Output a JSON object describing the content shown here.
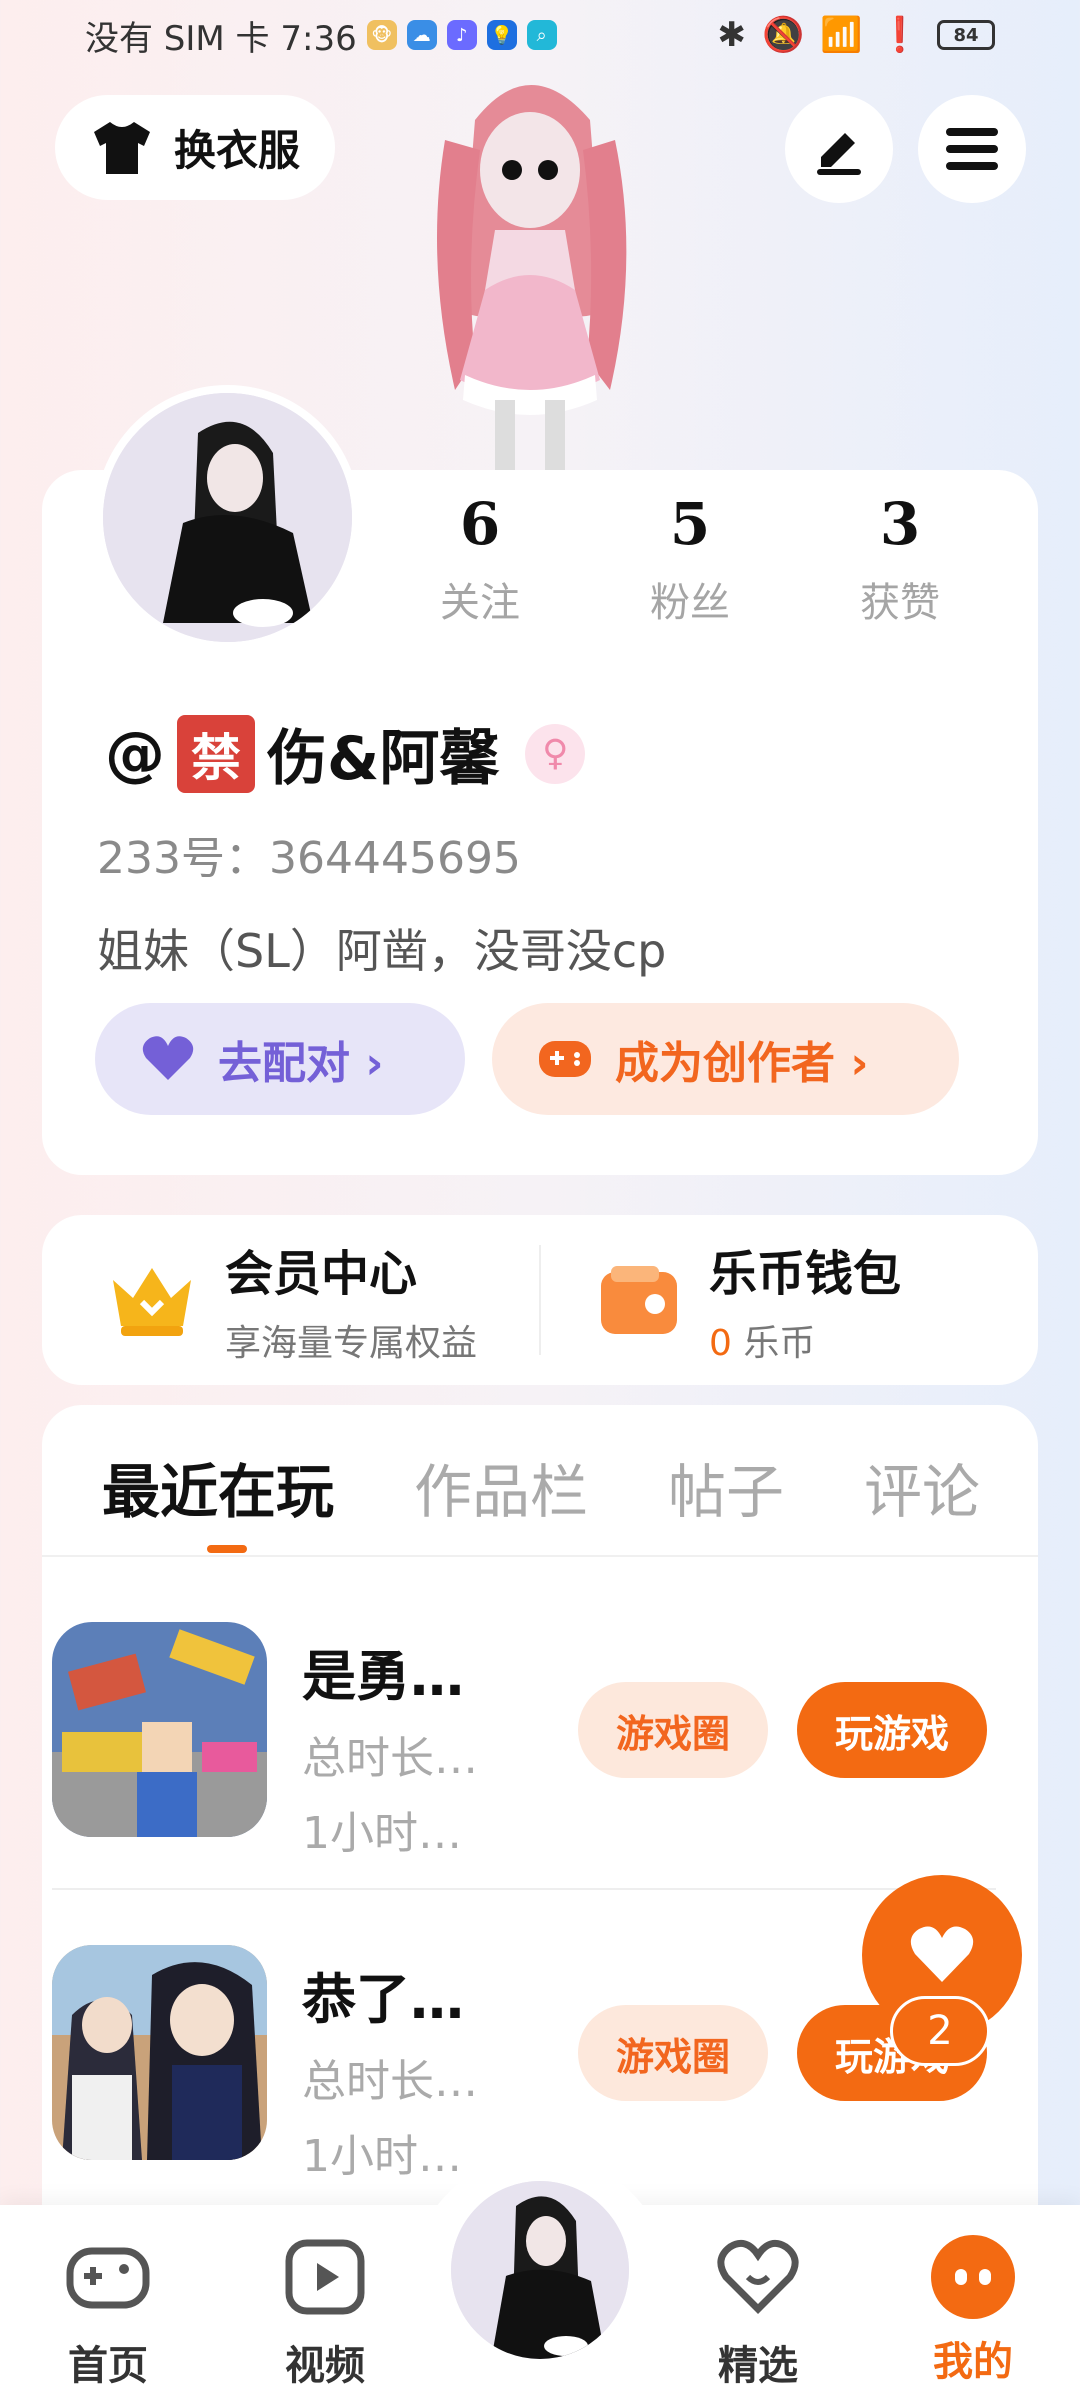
{
  "status_bar": {
    "carrier": "没有 SIM 卡 7:36",
    "battery": "84"
  },
  "header": {
    "dress_button_label": "换衣服"
  },
  "profile": {
    "stats": [
      {
        "value": "6",
        "label": "关注"
      },
      {
        "value": "5",
        "label": "粉丝"
      },
      {
        "value": "3",
        "label": "获赞"
      }
    ],
    "username_prefix": "@",
    "ban_badge": "禁",
    "username": "伤&阿馨",
    "gender_symbol": "♀",
    "uid": "233号：364445695",
    "bio": "姐妹（SL）阿凿，没哥没cp",
    "match_button": "去配对 ›",
    "creator_button": "成为创作者 ›"
  },
  "vip": {
    "member_title": "会员中心",
    "member_sub": "享海量专属权益",
    "wallet_title": "乐币钱包",
    "wallet_amount": "0",
    "wallet_unit": "乐币"
  },
  "tabs": [
    "最近在玩",
    "作品栏",
    "帖子",
    "评论"
  ],
  "games": [
    {
      "name": "是勇…",
      "time": "总时长…",
      "hours": "1小时…",
      "circle_label": "游戏圈",
      "play_label": "玩游戏"
    },
    {
      "name": "恭了…",
      "time": "总时长…",
      "hours": "1小时…",
      "circle_label": "游戏圈",
      "play_label": "玩游戏"
    }
  ],
  "fab": {
    "count": "2"
  },
  "bottom_nav": [
    {
      "label": "首页"
    },
    {
      "label": "视频"
    },
    {
      "label": "精选"
    },
    {
      "label": "我的"
    }
  ]
}
